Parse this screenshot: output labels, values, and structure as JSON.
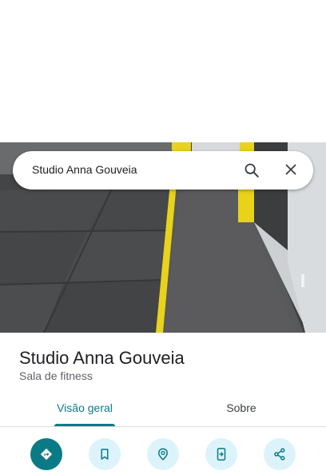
{
  "search": {
    "query": "Studio Anna Gouveia"
  },
  "place": {
    "name": "Studio Anna Gouveia",
    "category": "Sala de fitness"
  },
  "tabs": [
    {
      "label": "Visão geral",
      "selected": true
    },
    {
      "label": "Sobre",
      "selected": false
    }
  ],
  "actions": [
    {
      "icon": "directions-icon"
    },
    {
      "icon": "bookmark-icon"
    },
    {
      "icon": "nearby-icon"
    },
    {
      "icon": "send-to-phone-icon"
    },
    {
      "icon": "share-icon"
    }
  ],
  "colors": {
    "accent": "#0b7a87",
    "action_bg": "#ddf3fb",
    "text": "#202124",
    "secondary": "#5f6368"
  }
}
